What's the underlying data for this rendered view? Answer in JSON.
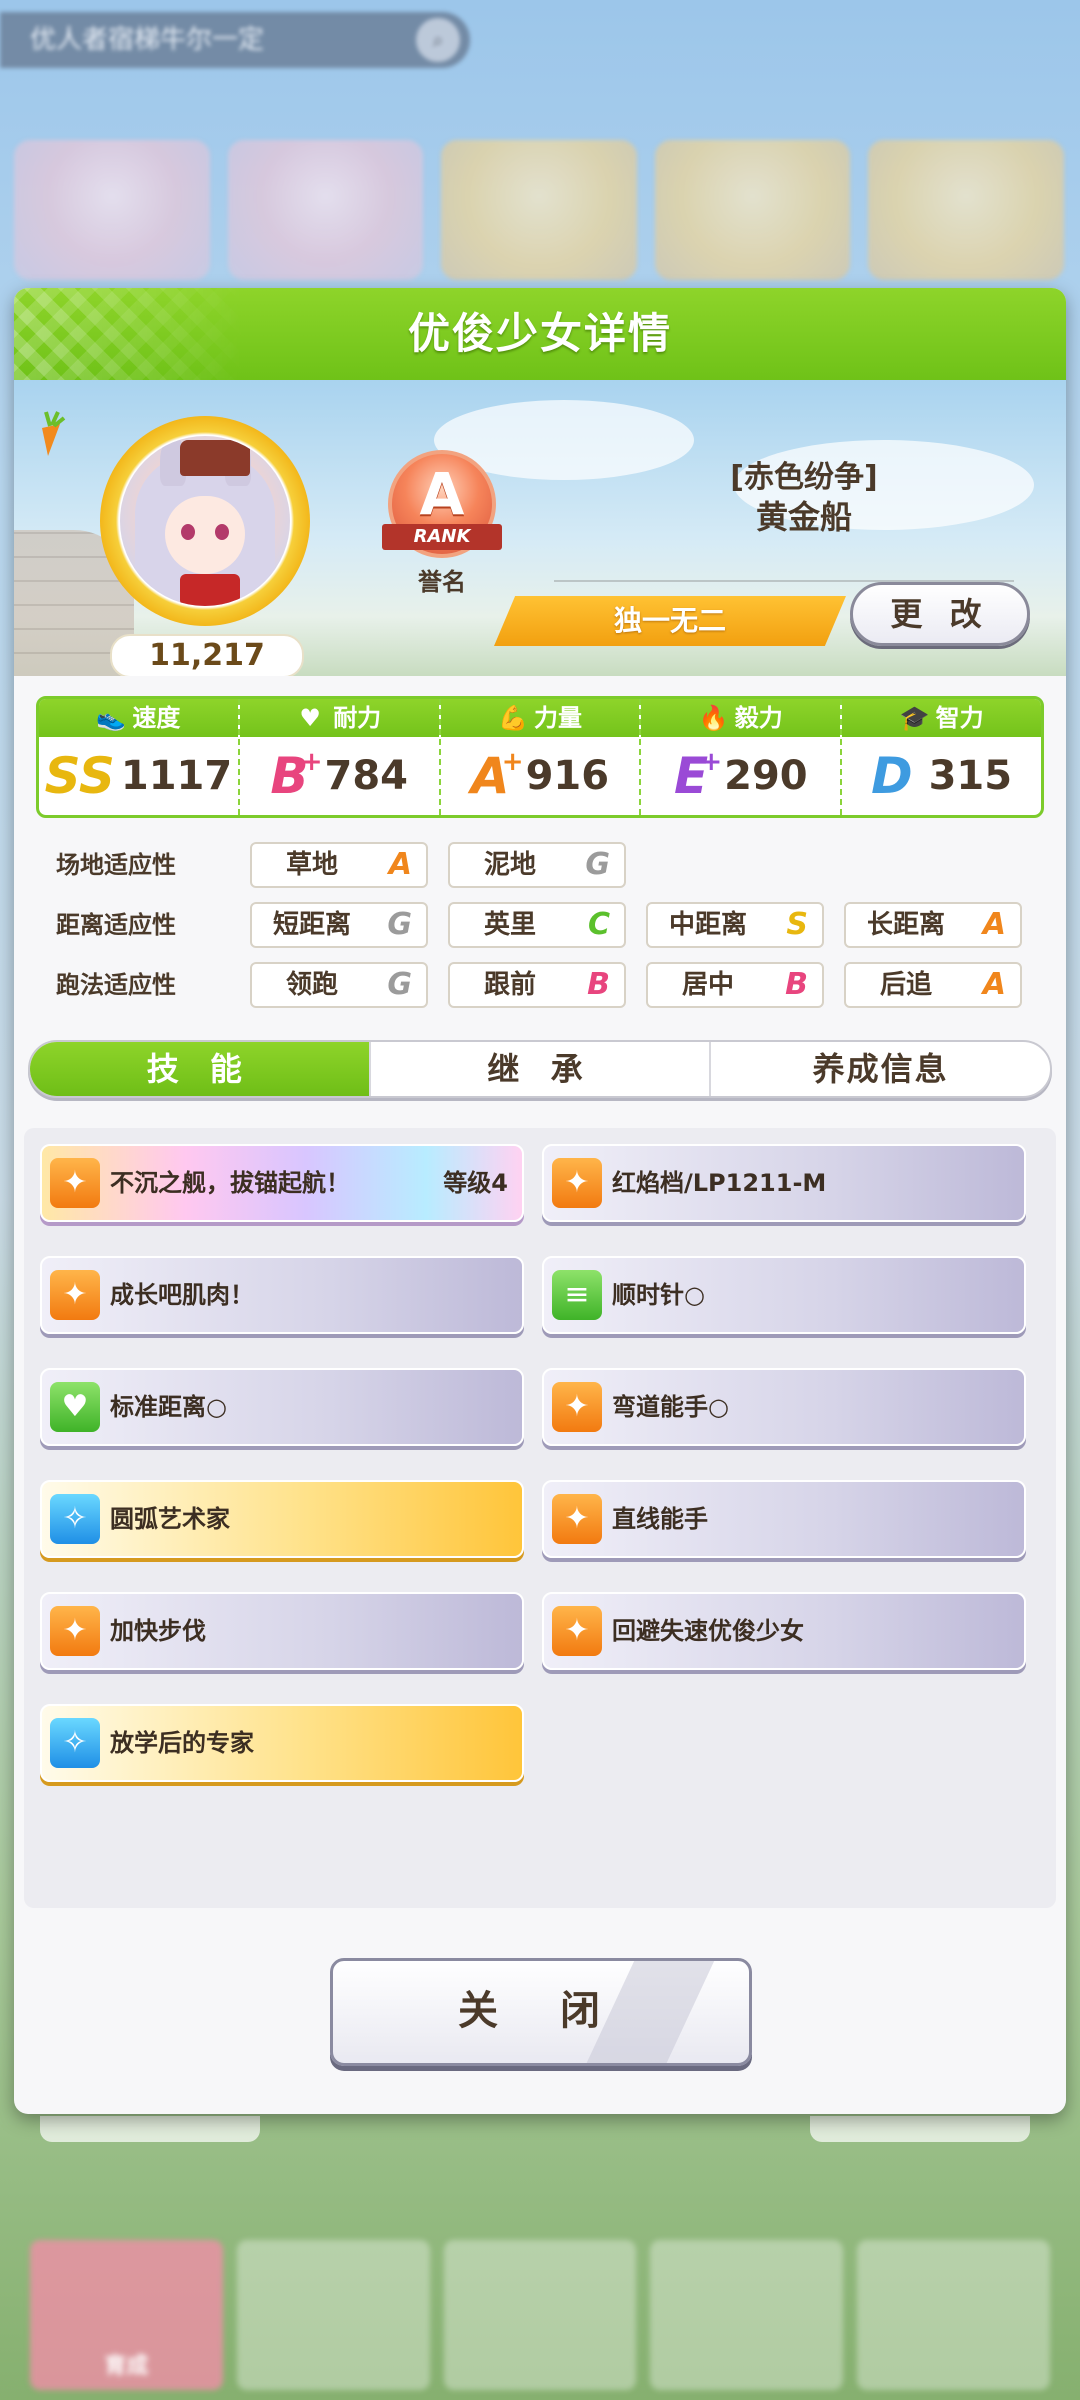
{
  "background": {
    "search_text": "优人者宿梯牛尔一定",
    "search_icon": "search-icon",
    "nav_items": [
      "育成",
      "",
      "",
      "",
      ""
    ]
  },
  "dialog": {
    "title": "优俊少女详情",
    "fans_count": "11,217",
    "rank": {
      "letter": "A",
      "ribbon": "RANK",
      "label": "誉名"
    },
    "epithet": "[赤色纷争]",
    "character_name": "黄金船",
    "unique_label": "独一无二",
    "change_button": "更 改"
  },
  "stats": [
    {
      "name": "速度",
      "icon": "shoe-icon",
      "grade": "SS",
      "plus": "",
      "value": "1117"
    },
    {
      "name": "耐力",
      "icon": "heart-icon",
      "grade": "B",
      "plus": "+",
      "value": "784"
    },
    {
      "name": "力量",
      "icon": "muscle-icon",
      "grade": "A",
      "plus": "+",
      "value": "916"
    },
    {
      "name": "毅力",
      "icon": "flame-icon",
      "grade": "E",
      "plus": "+",
      "value": "290"
    },
    {
      "name": "智力",
      "icon": "graduation-cap-icon",
      "grade": "D",
      "plus": "",
      "value": "315"
    }
  ],
  "aptitude": {
    "field": {
      "label": "场地适应性",
      "items": [
        {
          "name": "草地",
          "grade": "A"
        },
        {
          "name": "泥地",
          "grade": "G"
        }
      ]
    },
    "distance": {
      "label": "距离适应性",
      "items": [
        {
          "name": "短距离",
          "grade": "G"
        },
        {
          "name": "英里",
          "grade": "C"
        },
        {
          "name": "中距离",
          "grade": "S"
        },
        {
          "name": "长距离",
          "grade": "A"
        }
      ]
    },
    "style": {
      "label": "跑法适应性",
      "items": [
        {
          "name": "领跑",
          "grade": "G"
        },
        {
          "name": "跟前",
          "grade": "B"
        },
        {
          "name": "居中",
          "grade": "B"
        },
        {
          "name": "后追",
          "grade": "A"
        }
      ]
    }
  },
  "tabs": [
    "技 能",
    "继 承",
    "养成信息"
  ],
  "active_tab": 0,
  "skills": [
    {
      "name": "不沉之舰，拔锚起航！",
      "level": "等级4",
      "style": "rainbow",
      "icon": "speed-skill-icon"
    },
    {
      "name": "红焰档/LP1211-M",
      "level": "",
      "style": "normal",
      "icon": "speed-skill-icon"
    },
    {
      "name": "成长吧肌肉！",
      "level": "",
      "style": "normal",
      "icon": "speed-skill-icon"
    },
    {
      "name": "顺时针○",
      "level": "",
      "style": "normal",
      "icon": "green-card-skill-icon"
    },
    {
      "name": "标准距离○",
      "level": "",
      "style": "normal",
      "icon": "heart-skill-icon"
    },
    {
      "name": "弯道能手○",
      "level": "",
      "style": "normal",
      "icon": "speed-skill-icon"
    },
    {
      "name": "圆弧艺术家",
      "level": "",
      "style": "gold",
      "icon": "sparkle-skill-icon"
    },
    {
      "name": "直线能手",
      "level": "",
      "style": "normal",
      "icon": "speed-skill-icon"
    },
    {
      "name": "加快步伐",
      "level": "",
      "style": "normal",
      "icon": "speed-skill-icon"
    },
    {
      "name": "回避失速优俊少女",
      "level": "",
      "style": "normal",
      "icon": "speed-skill-icon"
    },
    {
      "name": "放学后的专家",
      "level": "",
      "style": "gold",
      "icon": "sparkle-skill-icon"
    }
  ],
  "close_button": "关 闭",
  "colors": {
    "header_green": "#7ccb2b",
    "grade_A": "#f0861c",
    "grade_B": "#e8457e",
    "grade_C": "#5bc02c",
    "grade_G": "#9b9b9b",
    "grade_S": "#e8b70f"
  }
}
